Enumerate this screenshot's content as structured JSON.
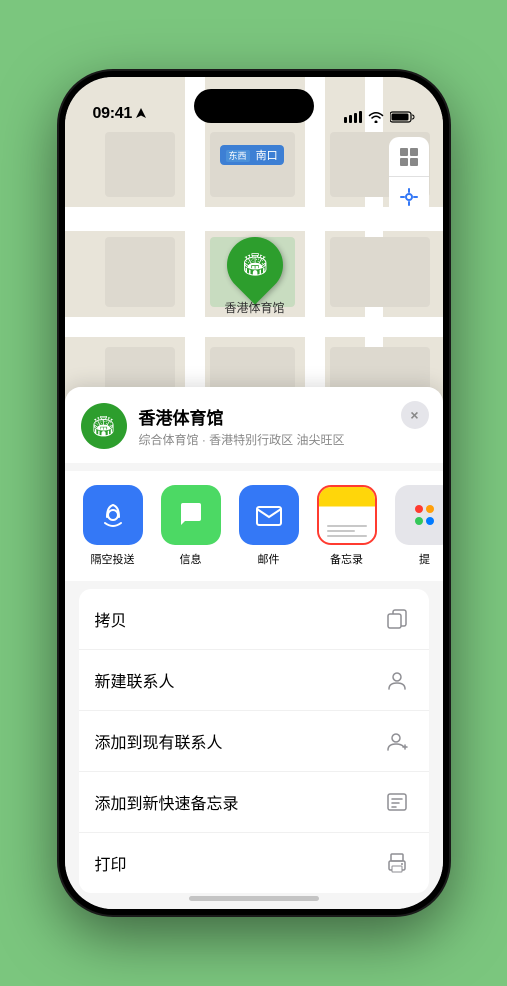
{
  "status": {
    "time": "09:41",
    "location_arrow": true
  },
  "map": {
    "label": "南口",
    "marker_label": "香港体育馆"
  },
  "controls": {
    "map_icon": "🗺",
    "location_icon": "⊳"
  },
  "place": {
    "name": "香港体育馆",
    "description": "综合体育馆 · 香港特别行政区 油尖旺区",
    "icon": "🏟"
  },
  "share_items": [
    {
      "id": "airdrop",
      "label": "隔空投送",
      "icon_type": "airdrop"
    },
    {
      "id": "message",
      "label": "信息",
      "icon_type": "message"
    },
    {
      "id": "mail",
      "label": "邮件",
      "icon_type": "mail"
    },
    {
      "id": "notes",
      "label": "备忘录",
      "icon_type": "notes"
    }
  ],
  "more_colors": [
    "#ff3b30",
    "#ff9f0a",
    "#34c759",
    "#007aff",
    "#af52de"
  ],
  "actions": [
    {
      "id": "copy",
      "label": "拷贝",
      "icon": "📋"
    },
    {
      "id": "new-contact",
      "label": "新建联系人",
      "icon": "👤"
    },
    {
      "id": "add-existing",
      "label": "添加到现有联系人",
      "icon": "👤+"
    },
    {
      "id": "add-quick-note",
      "label": "添加到新快速备忘录",
      "icon": "📝"
    },
    {
      "id": "print",
      "label": "打印",
      "icon": "🖨"
    }
  ],
  "close_label": "×"
}
